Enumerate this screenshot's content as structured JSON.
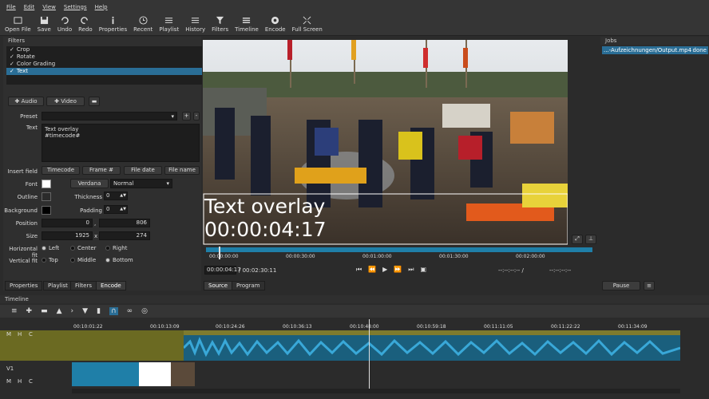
{
  "menu": [
    "File",
    "Edit",
    "View",
    "Settings",
    "Help"
  ],
  "toolbar": [
    {
      "label": "Open File",
      "icon": "open-file-icon"
    },
    {
      "label": "Save",
      "icon": "save-icon"
    },
    {
      "label": "Undo",
      "icon": "undo-icon"
    },
    {
      "label": "Redo",
      "icon": "redo-icon"
    },
    {
      "label": "Properties",
      "icon": "info-icon"
    },
    {
      "label": "Recent",
      "icon": "clock-icon"
    },
    {
      "label": "Playlist",
      "icon": "list-icon"
    },
    {
      "label": "History",
      "icon": "history-icon"
    },
    {
      "label": "Filters",
      "icon": "funnel-icon"
    },
    {
      "label": "Timeline",
      "icon": "timeline-icon"
    },
    {
      "label": "Encode",
      "icon": "encode-icon"
    },
    {
      "label": "Full Screen",
      "icon": "fullscreen-icon"
    }
  ],
  "filters": {
    "title": "Filters",
    "items": [
      "Crop",
      "Rotate",
      "Color Grading",
      "Text"
    ],
    "selected_index": 3,
    "audio_btn": "Audio",
    "video_btn": "Video",
    "preset_label": "Preset",
    "text_label": "Text",
    "text_value_line1": "Text overlay",
    "text_value_line2": "#timecode#",
    "insert_field_label": "Insert field",
    "insert_buttons": [
      "Timecode",
      "Frame #",
      "File date",
      "File name"
    ],
    "font_label": "Font",
    "font_name": "Verdana",
    "font_style": "Normal",
    "outline_label": "Outline",
    "thickness_label": "Thickness",
    "thickness_value": "0",
    "background_label": "Background",
    "padding_label": "Padding",
    "padding_value": "0",
    "position_label": "Position",
    "position_x": "0",
    "position_y": "806",
    "size_label": "Size",
    "size_w": "1925",
    "size_h": "274",
    "hfit_label": "Horizontal fit",
    "hfit_options": [
      "Left",
      "Center",
      "Right"
    ],
    "vfit_label": "Vertical fit",
    "vfit_options": [
      "Top",
      "Middle",
      "Bottom"
    ],
    "bottom_tabs": [
      "Properties",
      "Playlist",
      "Filters",
      "Encode"
    ]
  },
  "preview": {
    "overlay_line1": "Text overlay",
    "overlay_line2": "00:00:04:17",
    "ruler_labels": [
      "00:00:00:00",
      "00:00:30:00",
      "00:01:00:00",
      "00:01:30:00",
      "00:02:00:00"
    ],
    "current_time": "00:00:04:17",
    "total_time": "/ 00:02:30:11",
    "in_point": "--:--:--:-- /",
    "out_point": "--:--:--:--",
    "tabs": [
      "Source",
      "Program"
    ]
  },
  "jobs": {
    "title": "Jobs",
    "item": "...-Aufzeichnungen/Output.mp4",
    "status": "done",
    "pause_btn": "Pause"
  },
  "timeline": {
    "title": "Timeline",
    "ruler": [
      "00:10:01:22",
      "00:10:13:09",
      "00:10:24:26",
      "00:10:36:13",
      "00:10:48:00",
      "00:10:59:18",
      "00:11:11:05",
      "00:11:22:22",
      "00:11:34:09"
    ],
    "track_a_buttons": [
      "M",
      "H",
      "C"
    ],
    "track_v_name": "V1",
    "track_v_buttons": [
      "M",
      "H",
      "C"
    ]
  },
  "colors": {
    "selection": "#2a6e96",
    "audio_clip": "#1f7fa8",
    "track_olive": "#6b6a22"
  }
}
